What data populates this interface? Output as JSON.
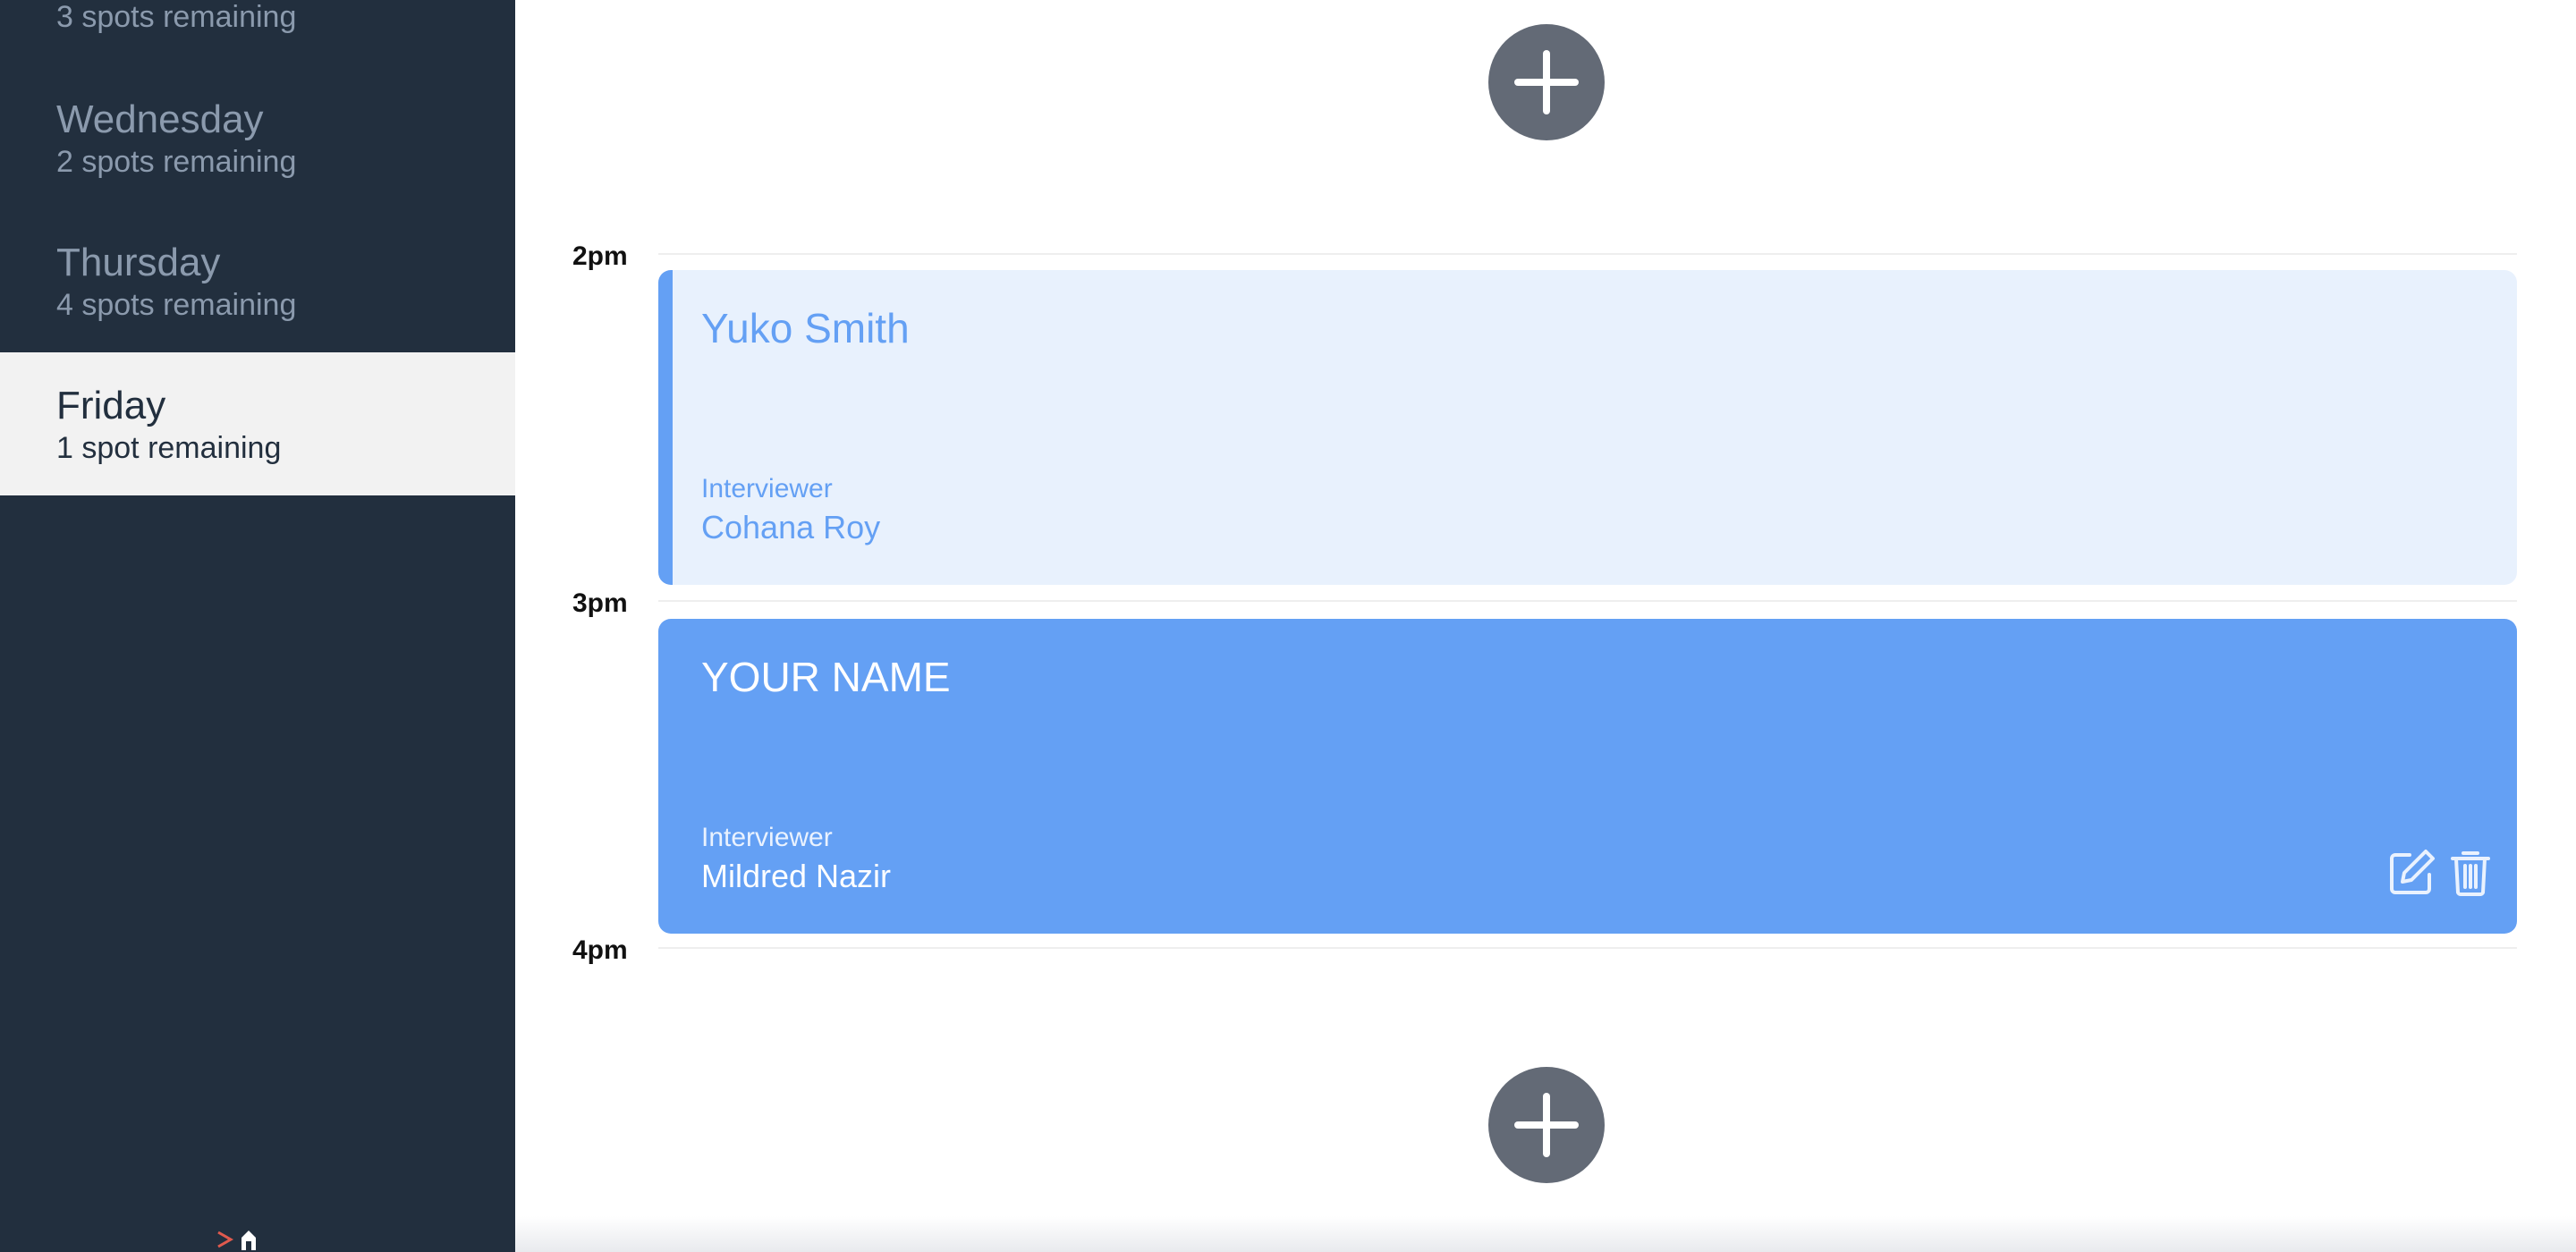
{
  "sidebar": {
    "days": [
      {
        "name": "",
        "spots": "3 spots remaining"
      },
      {
        "name": "Wednesday",
        "spots": "2 spots remaining"
      },
      {
        "name": "Thursday",
        "spots": "4 spots remaining"
      },
      {
        "name": "Friday",
        "spots": "1 spot remaining"
      }
    ],
    "logo_icon": "lhl-logo-icon"
  },
  "schedule": {
    "times": [
      "2pm",
      "3pm",
      "4pm"
    ],
    "appointments": [
      {
        "student": "Yuko Smith",
        "interviewer_label": "Interviewer",
        "interviewer": "Cohana Roy"
      },
      {
        "student": "YOUR NAME",
        "interviewer_label": "Interviewer",
        "interviewer": "Mildred Nazir",
        "actions": [
          "edit-icon",
          "trash-icon"
        ]
      }
    ],
    "add_icon": "plus-icon"
  },
  "colors": {
    "sidebar_bg": "#222f3e",
    "selected_bg": "#f2f2f2",
    "accent": "#64a0f4",
    "booked_bg": "#e8f1fd",
    "add_button": "#636a76"
  }
}
